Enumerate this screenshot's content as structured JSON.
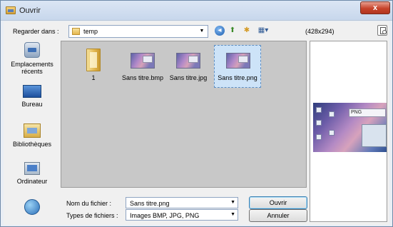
{
  "window": {
    "title": "Ouvrir",
    "close_label": "x"
  },
  "toolbar": {
    "look_in_label": "Regarder dans :",
    "look_in_value": "temp",
    "dimensions": "(428x294)"
  },
  "places": [
    {
      "label": "Emplacements récents",
      "icon": "recent-places-icon"
    },
    {
      "label": "Bureau",
      "icon": "desktop-icon"
    },
    {
      "label": "Bibliothèques",
      "icon": "libraries-icon"
    },
    {
      "label": "Ordinateur",
      "icon": "computer-icon"
    },
    {
      "label": "",
      "icon": "network-icon"
    }
  ],
  "files": [
    {
      "name": "1",
      "type": "folder"
    },
    {
      "name": "Sans titre.bmp",
      "type": "image"
    },
    {
      "name": "Sans titre.jpg",
      "type": "image"
    },
    {
      "name": "Sans titre.png",
      "type": "image",
      "selected": true
    }
  ],
  "preview": {
    "overlay_text": "PNG"
  },
  "form": {
    "file_name_label": "Nom du fichier :",
    "file_name_value": "Sans titre.png",
    "file_type_label": "Types de fichiers :",
    "file_type_value": "Images BMP, JPG, PNG",
    "open_label": "Ouvrir",
    "cancel_label": "Annuler"
  },
  "colors": {
    "accent": "#3c7fb1",
    "list_bg": "#c8c8c8",
    "selection": "#cde3f8"
  }
}
